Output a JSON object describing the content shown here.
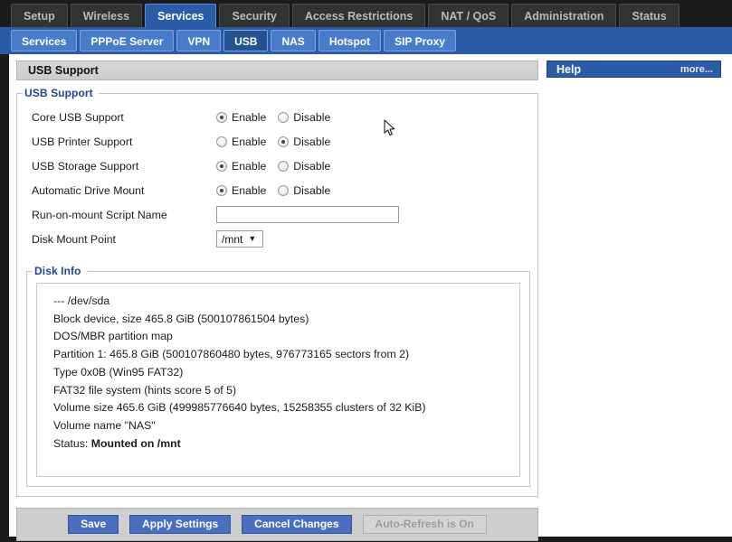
{
  "topnav": {
    "tabs": [
      {
        "label": "Setup",
        "active": false
      },
      {
        "label": "Wireless",
        "active": false
      },
      {
        "label": "Services",
        "active": true
      },
      {
        "label": "Security",
        "active": false
      },
      {
        "label": "Access Restrictions",
        "active": false
      },
      {
        "label": "NAT / QoS",
        "active": false
      },
      {
        "label": "Administration",
        "active": false
      },
      {
        "label": "Status",
        "active": false
      }
    ]
  },
  "subnav": {
    "tabs": [
      {
        "label": "Services",
        "active": false
      },
      {
        "label": "PPPoE Server",
        "active": false
      },
      {
        "label": "VPN",
        "active": false
      },
      {
        "label": "USB",
        "active": true
      },
      {
        "label": "NAS",
        "active": false
      },
      {
        "label": "Hotspot",
        "active": false
      },
      {
        "label": "SIP Proxy",
        "active": false
      }
    ]
  },
  "page": {
    "title": "USB Support"
  },
  "usb_support": {
    "legend": "USB Support",
    "rows": [
      {
        "label": "Core USB Support",
        "type": "radio",
        "options": [
          "Enable",
          "Disable"
        ],
        "selected": "Enable"
      },
      {
        "label": "USB Printer Support",
        "type": "radio",
        "options": [
          "Enable",
          "Disable"
        ],
        "selected": "Disable"
      },
      {
        "label": "USB Storage Support",
        "type": "radio",
        "options": [
          "Enable",
          "Disable"
        ],
        "selected": "Enable"
      },
      {
        "label": "Automatic Drive Mount",
        "type": "radio",
        "options": [
          "Enable",
          "Disable"
        ],
        "selected": "Enable"
      }
    ],
    "script_name": {
      "label": "Run-on-mount Script Name",
      "value": "",
      "placeholder": ""
    },
    "mount_point": {
      "label": "Disk Mount Point",
      "value": "/mnt",
      "caret": "▼"
    }
  },
  "disk_info": {
    "legend": "Disk Info",
    "lines": [
      {
        "text": "--- /dev/sda",
        "bold_suffix": ""
      },
      {
        "text": "Block device, size 465.8 GiB (500107861504 bytes)",
        "bold_suffix": ""
      },
      {
        "text": "DOS/MBR partition map",
        "bold_suffix": ""
      },
      {
        "text": "Partition 1: 465.8 GiB (500107860480 bytes, 976773165 sectors from 2)",
        "bold_suffix": ""
      },
      {
        "text": "Type 0x0B (Win95 FAT32)",
        "bold_suffix": ""
      },
      {
        "text": "FAT32 file system (hints score 5 of 5)",
        "bold_suffix": ""
      },
      {
        "text": "Volume size 465.6 GiB (499985776640 bytes, 15258355 clusters of 32 KiB)",
        "bold_suffix": ""
      },
      {
        "text": "Volume name \"NAS\"",
        "bold_suffix": ""
      },
      {
        "text": "Status: ",
        "bold_suffix": "Mounted on /mnt"
      }
    ]
  },
  "buttons": {
    "save": "Save",
    "apply": "Apply Settings",
    "cancel": "Cancel Changes",
    "autorefresh": "Auto-Refresh is On"
  },
  "help": {
    "title": "Help",
    "more": "more..."
  },
  "colors": {
    "accent_blue": "#2a5ca8",
    "subtab_blue": "#4a7ccc",
    "button_blue": "#4a6fc0",
    "legend_blue": "#22458c",
    "dark_nav": "#1b1b1b"
  }
}
